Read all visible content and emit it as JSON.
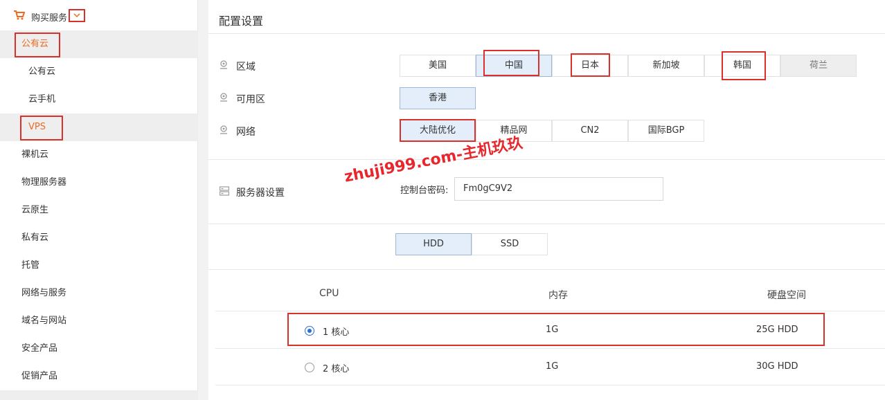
{
  "sidebar": {
    "header_label": "购买服务",
    "items": [
      {
        "label": "公有云"
      },
      {
        "label": "公有云"
      },
      {
        "label": "云手机"
      },
      {
        "label": "VPS"
      },
      {
        "label": "裸机云"
      },
      {
        "label": "物理服务器"
      },
      {
        "label": "云原生"
      },
      {
        "label": "私有云"
      },
      {
        "label": "托管"
      },
      {
        "label": "网络与服务"
      },
      {
        "label": "域名与网站"
      },
      {
        "label": "安全产品"
      },
      {
        "label": "促销产品"
      }
    ]
  },
  "main": {
    "title": "配置设置",
    "region": {
      "label": "区域",
      "options": [
        "美国",
        "中国",
        "日本",
        "新加坡",
        "韩国",
        "荷兰"
      ],
      "selected": "中国",
      "disabled": [
        "荷兰"
      ]
    },
    "zone": {
      "label": "可用区",
      "options": [
        "香港"
      ],
      "selected": "香港"
    },
    "network": {
      "label": "网络",
      "options": [
        "大陆优化",
        "精品网",
        "CN2",
        "国际BGP"
      ],
      "selected": "大陆优化"
    },
    "server_settings": {
      "label": "服务器设置",
      "password_label": "控制台密码:",
      "password_value": "Fm0gC9V2"
    },
    "disk_type": {
      "options": [
        "HDD",
        "SSD"
      ],
      "selected": "HDD"
    },
    "table": {
      "headers": [
        "CPU",
        "内存",
        "硬盘空间"
      ],
      "rows": [
        {
          "cpu": "1 核心",
          "memory": "1G",
          "disk": "25G HDD",
          "selected": true
        },
        {
          "cpu": "2 核心",
          "memory": "1G",
          "disk": "30G HDD",
          "selected": false
        }
      ]
    },
    "watermark": "zhuji999.com-主机玖玖"
  },
  "colors": {
    "accent_orange": "#ef6a1f",
    "highlight_red": "#d9302c",
    "selected_blue": "#e4eefb",
    "radio_blue": "#2a6fd6"
  }
}
